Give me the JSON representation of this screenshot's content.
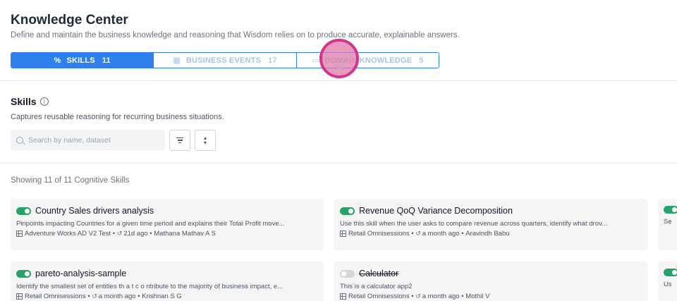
{
  "header": {
    "title": "Knowledge Center",
    "subtitle": "Define and maintain the business knowledge and reasoning that Wisdom relies on to produce accurate, explainable answers."
  },
  "tabs": [
    {
      "label": "SKILLS",
      "count": "11",
      "icon": "skills-icon",
      "active": true
    },
    {
      "label": "BUSINESS EVENTS",
      "count": "17",
      "icon": "calendar-icon",
      "active": false
    },
    {
      "label": "DOMAIN KNOWLEDGE",
      "count": "5",
      "icon": "book-icon",
      "active": false
    }
  ],
  "section": {
    "title": "Skills",
    "description": "Captures reusable reasoning for recurring business situations."
  },
  "search": {
    "placeholder": "Search by name, dataset",
    "value": ""
  },
  "list": {
    "showing": "Showing 11 of 11 Cognitive Skills"
  },
  "cards": [
    {
      "title": "Country Sales drivers analysis",
      "enabled": true,
      "description": "Pinpoints impacting Countries for a given time period and explains their Total Profit move...",
      "dataset": "Adventure Works AD V2 Test",
      "time": "21d ago",
      "author": "Mathana Mathav A S"
    },
    {
      "title": "Revenue QoQ Variance Decomposition",
      "enabled": true,
      "description": "Use this skill when the user asks to compare revenue across quarters, identify what drov...",
      "dataset": "Retail Omnisessions",
      "time": "a month ago",
      "author": "Aravindh Babu"
    },
    {
      "title": "pareto-analysis-sample",
      "enabled": true,
      "description": "Identify the smallest set of entities th a t c o ntribute to the majority of business impact, e...",
      "dataset": "Retail Omnisessions",
      "time": "a month ago",
      "author": "Krishnan S G"
    },
    {
      "title": "Calculator",
      "enabled": false,
      "description": "This is a calculator app2",
      "dataset": "Retail Omnisessions",
      "time": "a month ago",
      "author": "Mothil V"
    },
    {
      "title": "",
      "enabled": true,
      "description": "Segr",
      "dataset": "",
      "time": "",
      "author": ""
    },
    {
      "title": "",
      "enabled": true,
      "description": "Use",
      "dataset": "",
      "time": "",
      "author": ""
    }
  ],
  "colors": {
    "accent": "#2f80ed",
    "toggle_on": "#27a26a",
    "cursor": "#d6338a"
  }
}
